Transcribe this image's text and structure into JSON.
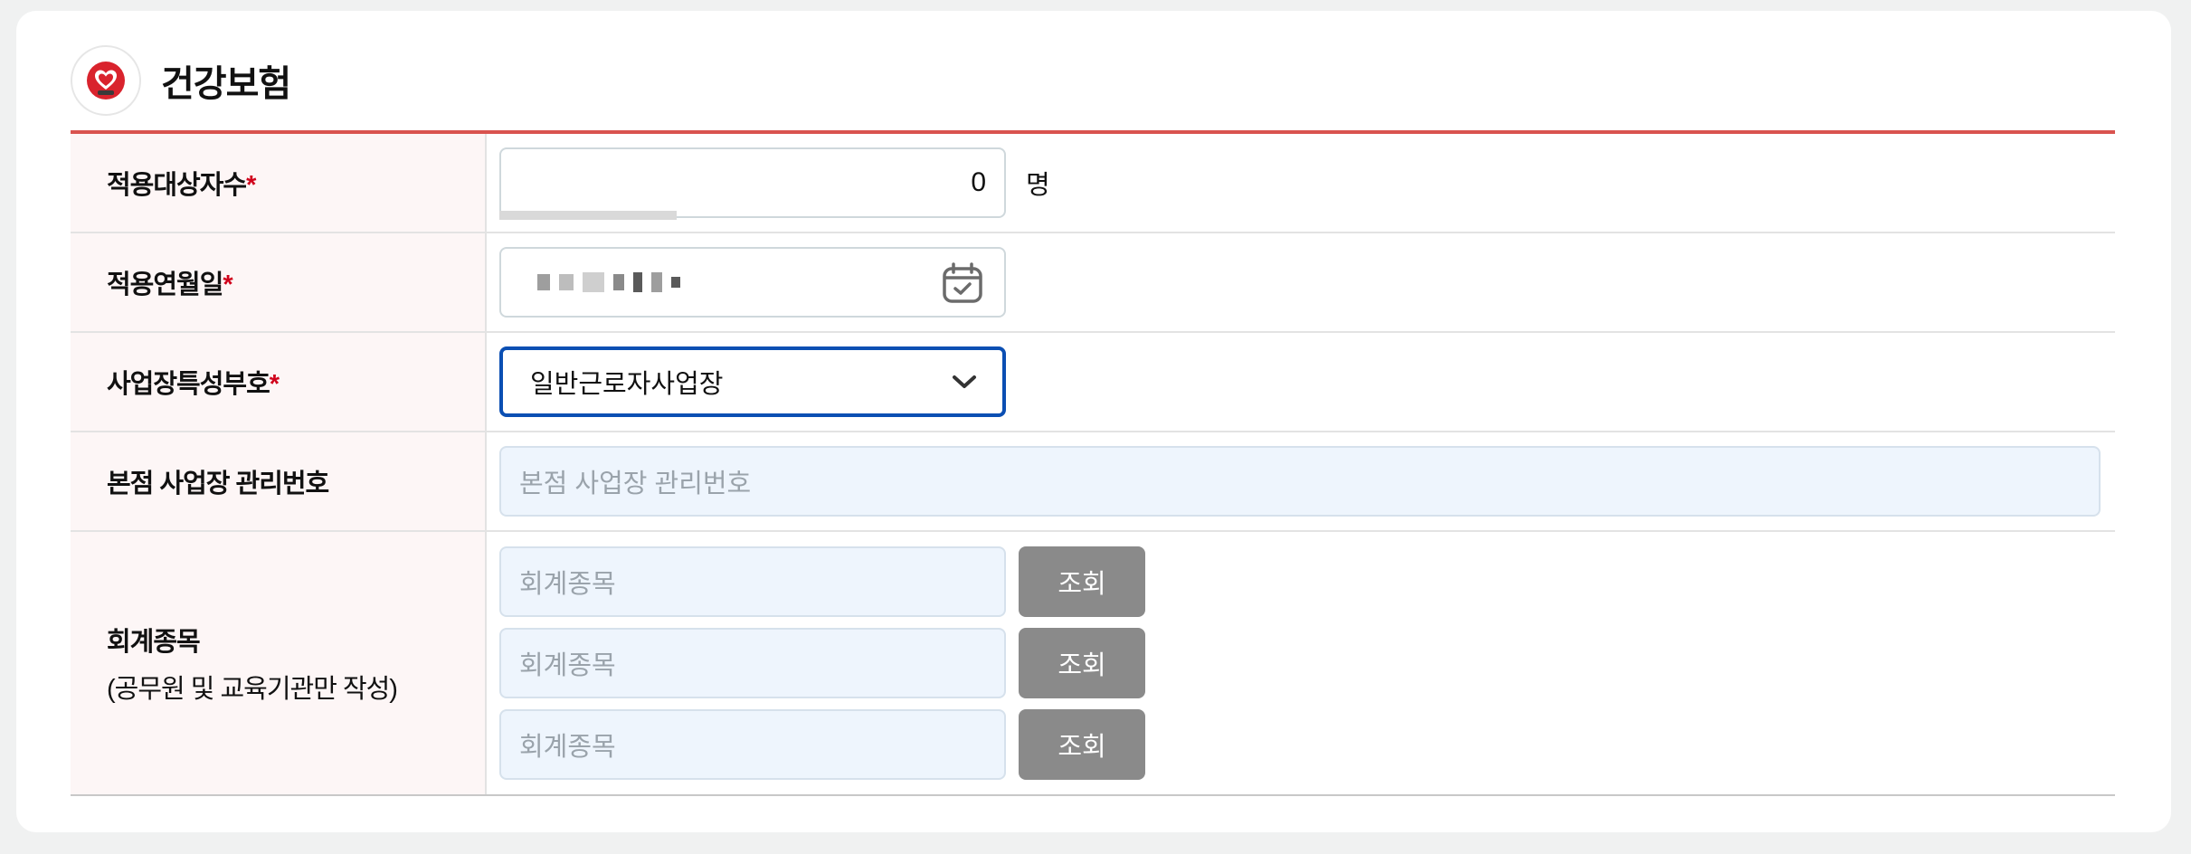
{
  "header": {
    "title": "건강보험",
    "icon": "heart-icon",
    "accent": "#d9534f"
  },
  "rows": {
    "insured_count": {
      "label": "적용대상자수",
      "required_mark": "*",
      "value": "0",
      "unit": "명"
    },
    "apply_date": {
      "label": "적용연월일",
      "required_mark": "*",
      "icon": "calendar-icon"
    },
    "workplace_code": {
      "label": "사업장특성부호",
      "required_mark": "*",
      "selected": "일반근로자사업장",
      "icon": "chevron-down-icon"
    },
    "hq_number": {
      "label": "본점 사업장 관리번호",
      "placeholder": "본점 사업장 관리번호"
    },
    "account": {
      "label": "회계종목",
      "sublabel": "(공무원 및 교육기관만 작성)",
      "items": [
        {
          "placeholder": "회계종목",
          "button": "조회"
        },
        {
          "placeholder": "회계종목",
          "button": "조회"
        },
        {
          "placeholder": "회계종목",
          "button": "조회"
        }
      ]
    }
  },
  "colors": {
    "focus_border": "#0b4fb3",
    "button_bg": "#8a8a8a",
    "required": "#d0021b",
    "label_bg": "#fdf6f6",
    "input_bg": "#eef5fd"
  }
}
